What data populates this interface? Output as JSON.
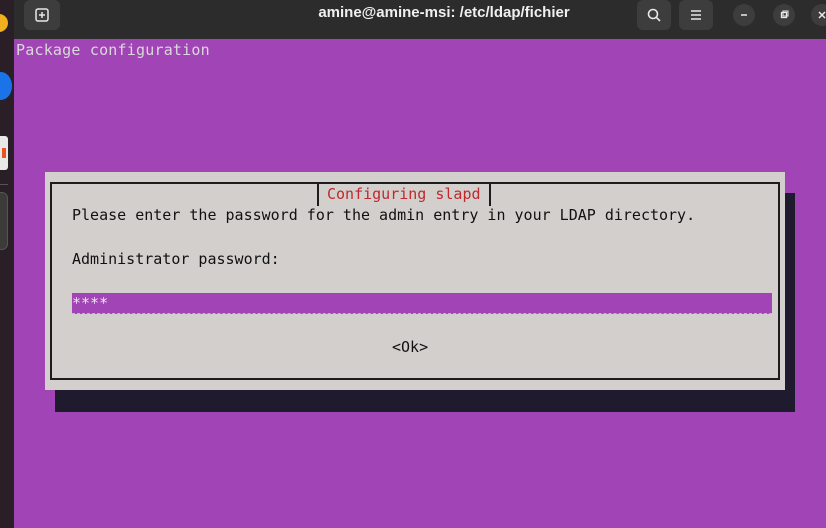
{
  "window": {
    "title": "amine@amine-msi: /etc/ldap/fichier"
  },
  "terminal": {
    "header": "Package configuration"
  },
  "dialog": {
    "title": "Configuring slapd",
    "prompt": "Please enter the password for the admin entry in your LDAP directory.",
    "field_label": "Administrator password:",
    "password_value": "****",
    "ok_label": "<Ok>"
  },
  "colors": {
    "terminal_bg": "#a144b6",
    "dialog_bg": "#d3cfcc",
    "dialog_title": "#c0282d"
  },
  "icons": {
    "new_tab": "new-tab-icon",
    "search": "search-icon",
    "menu": "hamburger-menu-icon",
    "minimize": "minimize-icon",
    "maximize": "maximize-icon",
    "close": "close-icon"
  }
}
